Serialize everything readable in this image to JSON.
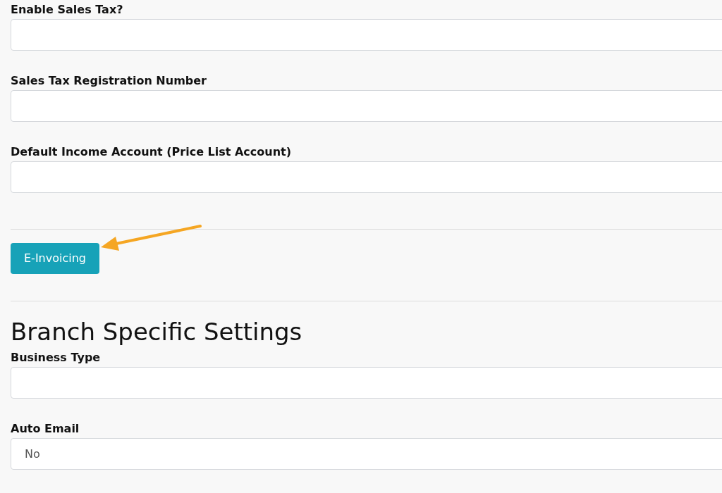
{
  "tax_fields": [
    {
      "label": "Enable Sales Tax?"
    },
    {
      "label": "Sales Tax Registration Number"
    },
    {
      "label": "Default Income Account (Price List Account)"
    }
  ],
  "e_invoicing_button": {
    "label": "E-Invoicing"
  },
  "branch_settings": {
    "heading": "Branch Specific Settings",
    "fields": [
      {
        "label": "Business Type"
      },
      {
        "label": "Auto Email",
        "value": "No"
      }
    ]
  }
}
